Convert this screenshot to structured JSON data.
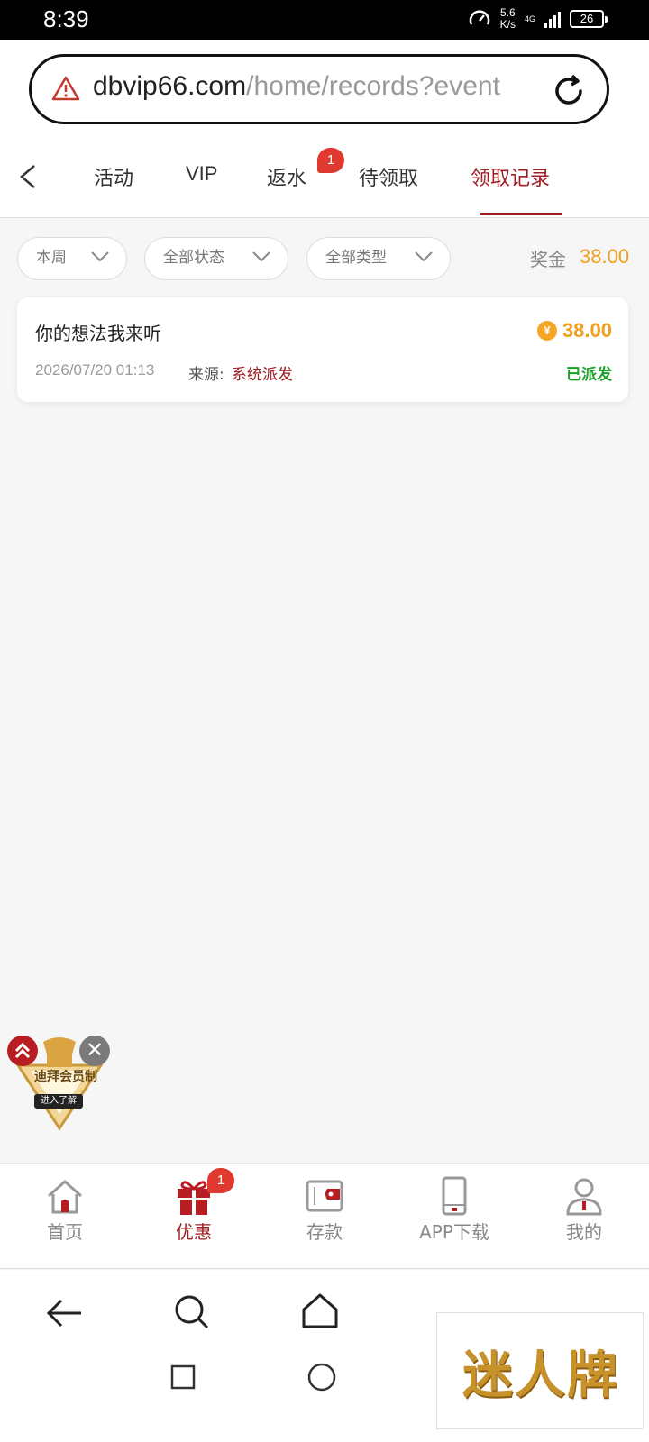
{
  "status_bar": {
    "time": "8:39",
    "net_speed_value": "5.6",
    "net_speed_unit": "K/s",
    "network_type": "4G",
    "battery": "26"
  },
  "browser": {
    "url_domain": "dbvip66.com",
    "url_path": "/home/records?event"
  },
  "tabs": [
    {
      "label": "活动"
    },
    {
      "label": "VIP"
    },
    {
      "label": "返水",
      "badge": "1"
    },
    {
      "label": "待领取"
    },
    {
      "label": "领取记录",
      "active": true
    }
  ],
  "filters": {
    "period": "本周",
    "status": "全部状态",
    "type": "全部类型"
  },
  "bonus": {
    "label": "奖金",
    "value": "38.00"
  },
  "records": [
    {
      "title": "你的想法我来听",
      "amount": "38.00",
      "time": "2026/07/20 01:13",
      "source_label": "来源:",
      "source": "系统派发",
      "status": "已派发",
      "currency_icon": "¥"
    }
  ],
  "floating_badge": {
    "title": "迪拜会员制",
    "button": "进入了解",
    "close": "✕"
  },
  "bottom_nav": [
    {
      "label": "首页",
      "icon": "home-icon"
    },
    {
      "label": "优惠",
      "icon": "gift-icon",
      "active": true,
      "badge": "1"
    },
    {
      "label": "存款",
      "icon": "wallet-icon"
    },
    {
      "label": "APP下载",
      "icon": "phone-icon"
    },
    {
      "label": "我的",
      "icon": "user-icon"
    }
  ],
  "watermark": {
    "text": "迷人牌"
  },
  "colors": {
    "brand": "#a01d22",
    "amount": "#f0a020",
    "success": "#1aa02a",
    "badge": "#e0392f"
  }
}
